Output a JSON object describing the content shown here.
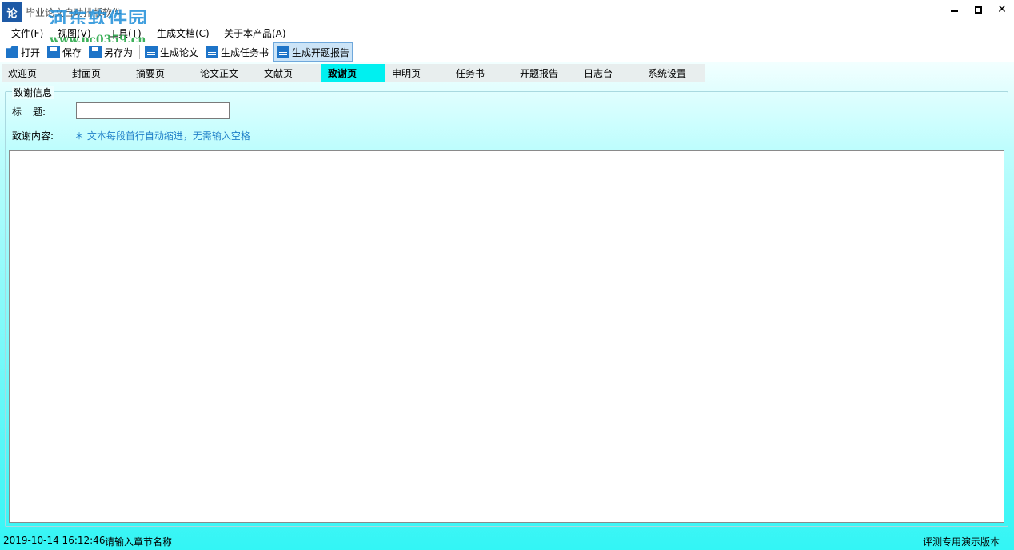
{
  "window": {
    "title": "毕业论文自动排版软件",
    "watermark": "河东软件园",
    "watermark_url": "www.pc0359.cn",
    "app_icon_glyph": "论"
  },
  "menu": {
    "items": [
      "文件(F)",
      "视图(V)",
      "工具(T)",
      "生成文档(C)",
      "关于本产品(A)"
    ]
  },
  "toolbar": {
    "open": "打开",
    "save": "保存",
    "save_as": "另存为",
    "gen_thesis": "生成论文",
    "gen_task": "生成任务书",
    "gen_proposal": "生成开题报告"
  },
  "tabs": [
    "欢迎页",
    "封面页",
    "摘要页",
    "论文正文",
    "文献页",
    "致谢页",
    "申明页",
    "任务书",
    "开题报告",
    "日志台",
    "系统设置"
  ],
  "active_tab_index": 5,
  "form": {
    "group_title": "致谢信息",
    "title_label_a": "标",
    "title_label_b": "题:",
    "title_value": "",
    "content_label": "致谢内容:",
    "hint": "＊ 文本每段首行自动缩进，无需输入空格",
    "content_value": ""
  },
  "status": {
    "datetime": "2019-10-14 16:12:46",
    "message": "请输入章节名称",
    "edition": "评测专用演示版本"
  },
  "colors": {
    "accent": "#1e74c8",
    "active_tab": "#00f0f0",
    "gradient_bottom": "#33f5f5"
  }
}
